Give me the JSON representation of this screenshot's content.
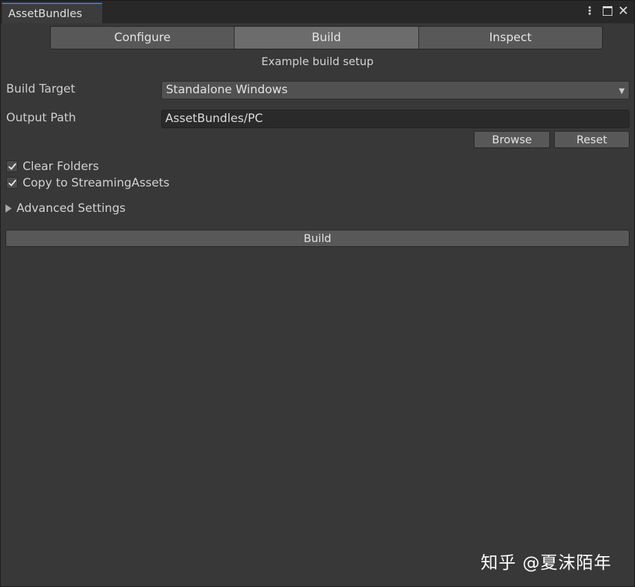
{
  "window": {
    "tab_title": "AssetBundles",
    "menu_glyph": "⋮",
    "close_glyph": "✕"
  },
  "toolbar": {
    "tabs": [
      {
        "label": "Configure",
        "active": false
      },
      {
        "label": "Build",
        "active": true
      },
      {
        "label": "Inspect",
        "active": false
      }
    ]
  },
  "main": {
    "subtitle": "Example build setup",
    "build_target": {
      "label": "Build Target",
      "value": "Standalone Windows"
    },
    "output_path": {
      "label": "Output Path",
      "value": "AssetBundles/PC"
    },
    "browse_label": "Browse",
    "reset_label": "Reset",
    "clear_folders": {
      "label": "Clear Folders",
      "checked": true
    },
    "copy_streaming": {
      "label": "Copy to StreamingAssets",
      "checked": true
    },
    "advanced_settings_label": "Advanced Settings",
    "build_button_label": "Build"
  },
  "watermark": "知乎 @夏沫陌年",
  "colors": {
    "background": "#383838",
    "titlebar": "#282828",
    "tab_accent": "#3a79bb",
    "button": "#585858",
    "button_active": "#6c6c6c",
    "field": "#2a2a2a"
  },
  "icons": [
    "kebab-menu-icon",
    "maximize-icon",
    "close-icon",
    "dropdown-arrow-icon",
    "checkmark-icon",
    "foldout-arrow-icon"
  ]
}
